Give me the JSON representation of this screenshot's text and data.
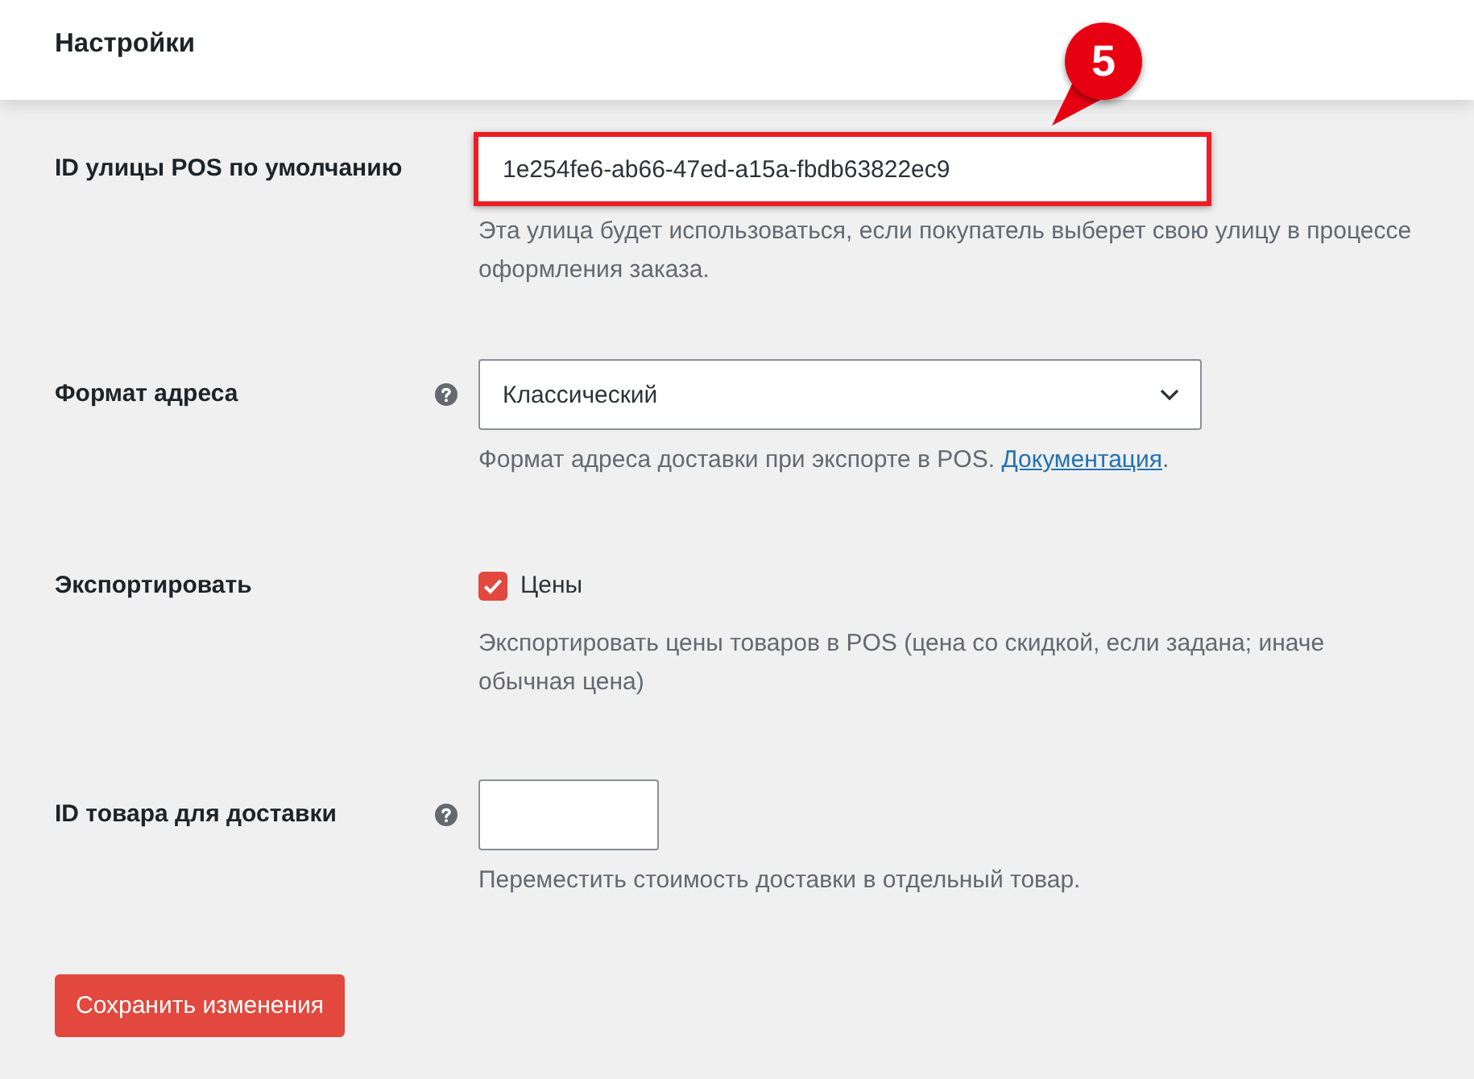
{
  "header": {
    "title": "Настройки"
  },
  "settings": [
    {
      "kind": "text",
      "label": "ID улицы POS по умолчанию",
      "help": false,
      "value": "1e254fe6-ab66-47ed-a15a-fbdb63822ec9",
      "callout": "5",
      "description": "Эта улица будет использоваться, если покупатель выберет свою улицу в процессе оформления заказа."
    },
    {
      "kind": "select",
      "label": "Формат адреса",
      "help": true,
      "value": "Классический",
      "description": "Формат адреса доставки при экспорте в POS.",
      "link": "Документация",
      "description_end": "."
    },
    {
      "kind": "checkbox",
      "label": "Экспортировать",
      "help": false,
      "option": "Цены",
      "checked": true,
      "description": "Экспортировать цены товаров в POS (цена со скидкой, если задана; иначе обычная цена)"
    },
    {
      "kind": "short",
      "label": "ID товара для доставки",
      "help": true,
      "description": "Переместить стоимость доставки в отдельный товар."
    }
  ],
  "save_button": "Сохранить изменения"
}
